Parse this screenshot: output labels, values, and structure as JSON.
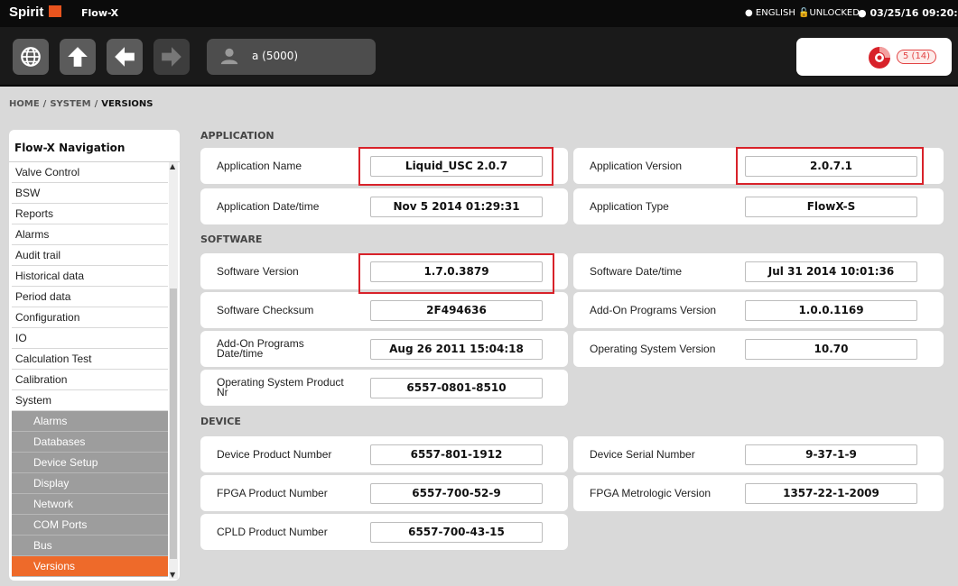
{
  "topbar": {
    "brand": "Spirit",
    "app_title": "Flow-X",
    "language": "ENGLISH",
    "lock_status": "UNLOCKED",
    "datetime": "03/25/16 09:20:3"
  },
  "toolbar": {
    "user": "a (5000)",
    "alarm_count": "5 (14)",
    "icons": [
      "globe-icon",
      "home-up-icon",
      "back-arrow-icon",
      "forward-arrow-icon",
      "user-icon",
      "alarm-bell-icon"
    ]
  },
  "breadcrumb": {
    "home": "HOME",
    "system": "SYSTEM",
    "current": "VERSIONS",
    "separator": "/"
  },
  "nav": {
    "title": "Flow-X Navigation",
    "items": [
      "Valve Control",
      "BSW",
      "Reports",
      "Alarms",
      "Audit trail",
      "Historical data",
      "Period data",
      "Configuration",
      "IO",
      "Calculation Test",
      "Calibration",
      "System"
    ],
    "subitems": [
      "Alarms",
      "Databases",
      "Device Setup",
      "Display",
      "Network",
      "COM Ports",
      "Bus",
      "Versions"
    ],
    "active": "Versions"
  },
  "sections": {
    "application": "APPLICATION",
    "software": "SOFTWARE",
    "device": "DEVICE"
  },
  "fields": {
    "app_name": {
      "label": "Application Name",
      "value": "Liquid_USC 2.0.7"
    },
    "app_version": {
      "label": "Application Version",
      "value": "2.0.7.1"
    },
    "app_datetime": {
      "label": "Application Date/time",
      "value": "Nov 5 2014 01:29:31"
    },
    "app_type": {
      "label": "Application Type",
      "value": "FlowX-S"
    },
    "sw_version": {
      "label": "Software Version",
      "value": "1.7.0.3879"
    },
    "sw_datetime": {
      "label": "Software Date/time",
      "value": "Jul 31 2014 10:01:36"
    },
    "sw_checksum": {
      "label": "Software Checksum",
      "value": "2F494636"
    },
    "addon_version": {
      "label": "Add-On Programs Version",
      "value": "1.0.0.1169"
    },
    "addon_datetime": {
      "label": "Add-On Programs Date/time",
      "value": "Aug 26 2011 15:04:18"
    },
    "os_version": {
      "label": "Operating System Version",
      "value": "10.70"
    },
    "os_product": {
      "label": "Operating System Product Nr",
      "value": "6557-0801-8510"
    },
    "dev_product": {
      "label": "Device Product Number",
      "value": "6557-801-1912"
    },
    "dev_serial": {
      "label": "Device Serial Number",
      "value": "9-37-1-9"
    },
    "fpga_product": {
      "label": "FPGA Product Number",
      "value": "6557-700-52-9"
    },
    "fpga_metro": {
      "label": "FPGA Metrologic Version",
      "value": "1357-22-1-2009"
    },
    "cpld_product": {
      "label": "CPLD Product Number",
      "value": "6557-700-43-15"
    }
  },
  "colors": {
    "accent": "#ee6a2a",
    "highlight": "#d8222a",
    "topbar": "#0b0b0b"
  }
}
